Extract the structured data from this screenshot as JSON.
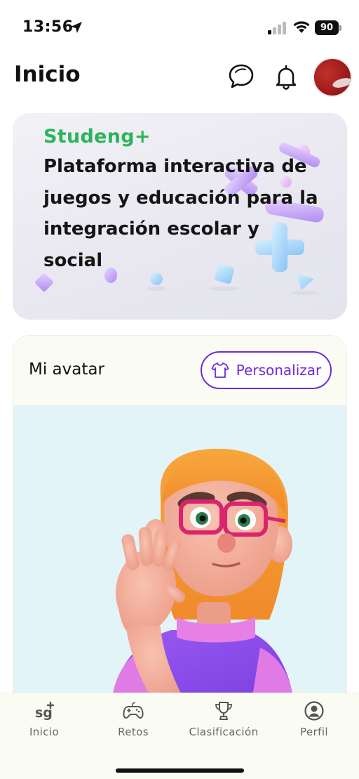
{
  "status_bar": {
    "time": "13:56",
    "battery": "90",
    "location_icon": "location-arrow-icon",
    "signal_icon": "cell-signal-icon",
    "wifi_icon": "wifi-icon"
  },
  "header": {
    "title": "Inicio",
    "chat_icon": "chat-bubbles-icon",
    "bell_icon": "bell-icon"
  },
  "banner": {
    "logo": "Studeng+",
    "text": "Plataforma interactiva de juegos y educación para la integración escolar y social"
  },
  "avatar_card": {
    "title": "Mi avatar",
    "customize_label": "Personalizar",
    "customize_icon": "shirt-icon"
  },
  "bottom_nav": {
    "items": [
      {
        "label": "Inicio",
        "icon": "sg-logo-icon"
      },
      {
        "label": "Retos",
        "icon": "gamepad-icon"
      },
      {
        "label": "Clasificación",
        "icon": "trophy-icon"
      },
      {
        "label": "Perfil",
        "icon": "user-circle-icon"
      }
    ],
    "home_logo_text": "sg+"
  },
  "colors": {
    "brand_green": "#2bb55a",
    "accent_purple": "#6d2bd9",
    "stage_bg": "#e3f4f8"
  }
}
